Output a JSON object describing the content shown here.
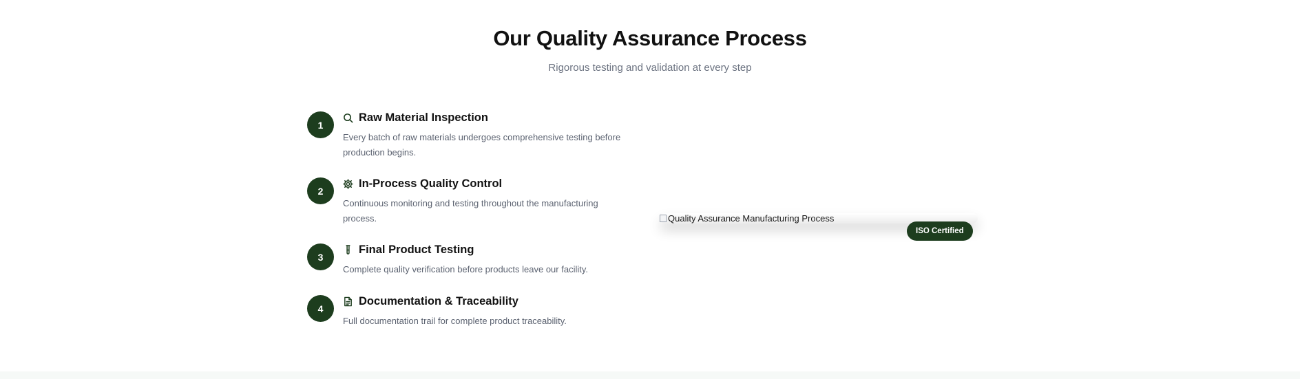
{
  "section": {
    "title": "Our Quality Assurance Process",
    "subtitle": "Rigorous testing and validation at every step"
  },
  "steps": [
    {
      "number": "1",
      "icon": "search-icon",
      "title": "Raw Material Inspection",
      "description": "Every batch of raw materials undergoes comprehensive testing before production begins."
    },
    {
      "number": "2",
      "icon": "gear-icon",
      "title": "In-Process Quality Control",
      "description": "Continuous monitoring and testing throughout the manufacturing process."
    },
    {
      "number": "3",
      "icon": "test-tube-icon",
      "title": "Final Product Testing",
      "description": "Complete quality verification before products leave our facility."
    },
    {
      "number": "4",
      "icon": "document-icon",
      "title": "Documentation & Traceability",
      "description": "Full documentation trail for complete product traceability."
    }
  ],
  "image": {
    "alt": "Quality Assurance Manufacturing Process"
  },
  "badge": {
    "label": "ISO Certified"
  },
  "colors": {
    "accent": "#1d3d1e",
    "muted_text": "#5b6270",
    "heading": "#111111"
  }
}
